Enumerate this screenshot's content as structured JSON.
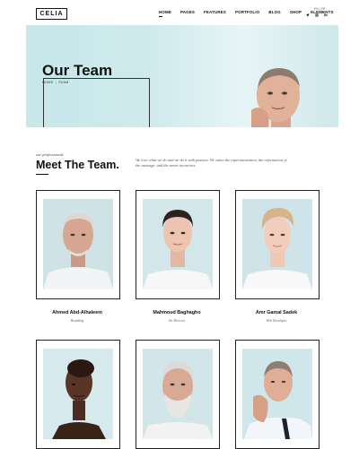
{
  "brand": {
    "logo_text": "CELIA"
  },
  "nav": {
    "items": [
      "HOME",
      "PAGES",
      "FEATURES",
      "PORTFOLIO",
      "BLOG",
      "SHOP",
      "ELEMENTS"
    ],
    "active": "HOME"
  },
  "lang": {
    "text": "EN | FR"
  },
  "social": [
    "twitter-icon",
    "instagram-icon",
    "behance-icon"
  ],
  "hero": {
    "title": "Our Team",
    "breadcrumb": [
      "HOME",
      "TEAM"
    ]
  },
  "section": {
    "kicker": "our professionals",
    "title": "Meet The Team.",
    "intro": "We love what we do and we do it with passion. We value the experimentation, the reformation of the message, and the smart incentives."
  },
  "team": [
    {
      "name": "Ahmed Abd-Alhaleem",
      "role": "Branding"
    },
    {
      "name": "Mahmoud Baghagho",
      "role": "Art Director"
    },
    {
      "name": "Amr Gamal Sadek",
      "role": "Web Developer"
    },
    {
      "name": "",
      "role": ""
    },
    {
      "name": "",
      "role": ""
    },
    {
      "name": "",
      "role": ""
    }
  ],
  "colors": {
    "accent": "#111111",
    "hero_bg": "#c7e7ea"
  }
}
